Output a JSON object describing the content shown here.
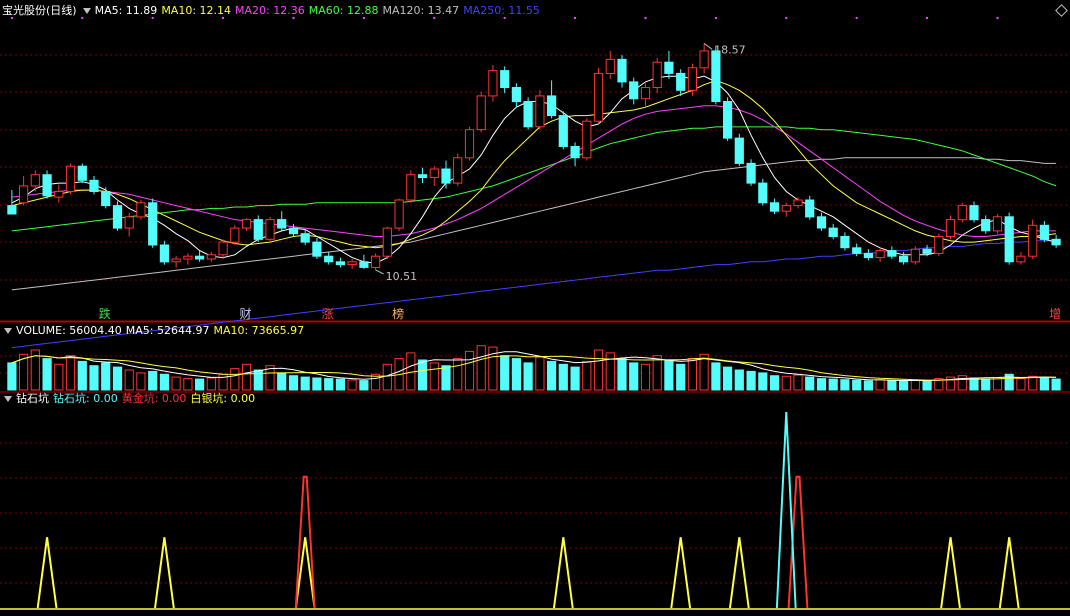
{
  "header": {
    "stock_title": "宝光股份(日线)",
    "ma5": "MA5: 11.89",
    "ma10": "MA10: 12.14",
    "ma20": "MA20: 12.36",
    "ma60": "MA60: 12.88",
    "ma120": "MA120: 13.47",
    "ma250": "MA250: 11.55"
  },
  "price_annotations": {
    "high": "18.57",
    "low": "10.51"
  },
  "event_markers": [
    {
      "label": "跌",
      "color": "#44dd44"
    },
    {
      "label": "财",
      "color": "#c8c8ff"
    },
    {
      "label": "涨",
      "color": "#ff4444"
    },
    {
      "label": "榜",
      "color": "#ffb060"
    },
    {
      "label": "增",
      "color": "#ff4444"
    }
  ],
  "volume_header": {
    "title": "VOLUME: 56004.40",
    "ma5": "MA5: 52644.97",
    "ma10": "MA10: 73665.97"
  },
  "indicator_header": {
    "name": "钻石坑",
    "diamond": "钻石坑: 0.00",
    "gold": "黄金坑: 0.00",
    "silver": "白银坑: 0.00"
  },
  "colors": {
    "up": "#ff3232",
    "down": "#54fcfc",
    "ma5": "#ffffff",
    "ma10": "#ffff40",
    "ma20": "#ff40ff",
    "ma60": "#40ff40",
    "ma120": "#c0c0c0",
    "ma250": "#4040ff",
    "grid": "#800000",
    "axis": "#b00000"
  },
  "chart_data": {
    "type": "candlestick",
    "count": 90,
    "price_ylim": [
      9.3,
      19.4
    ],
    "volume_ylim": [
      0,
      175000
    ],
    "indicator_ylim": [
      0,
      100
    ],
    "ohlc": [
      [
        12.8,
        13.35,
        12.6,
        12.5
      ],
      [
        12.9,
        13.85,
        12.8,
        13.5
      ],
      [
        13.5,
        14.05,
        13.3,
        13.9
      ],
      [
        13.9,
        14.05,
        13.05,
        13.15
      ],
      [
        13.1,
        13.55,
        12.9,
        13.3
      ],
      [
        13.3,
        14.3,
        13.2,
        14.2
      ],
      [
        14.2,
        14.3,
        13.6,
        13.7
      ],
      [
        13.7,
        13.85,
        13.2,
        13.3
      ],
      [
        13.3,
        13.45,
        12.7,
        12.8
      ],
      [
        12.8,
        12.95,
        11.9,
        12.0
      ],
      [
        12.0,
        12.55,
        11.7,
        12.4
      ],
      [
        12.4,
        13.0,
        12.3,
        12.9
      ],
      [
        12.9,
        13.05,
        11.3,
        11.4
      ],
      [
        11.4,
        11.55,
        10.7,
        10.8
      ],
      [
        10.8,
        11.0,
        10.6,
        10.9
      ],
      [
        10.9,
        11.1,
        10.7,
        11.0
      ],
      [
        11.0,
        11.2,
        10.8,
        10.9
      ],
      [
        10.9,
        11.15,
        10.8,
        11.05
      ],
      [
        11.05,
        11.6,
        10.9,
        11.5
      ],
      [
        11.5,
        12.1,
        11.4,
        12.0
      ],
      [
        12.0,
        12.35,
        11.9,
        12.3
      ],
      [
        12.3,
        12.45,
        11.5,
        11.6
      ],
      [
        11.6,
        12.4,
        11.5,
        12.3
      ],
      [
        12.3,
        12.6,
        11.9,
        12.0
      ],
      [
        12.0,
        12.15,
        11.7,
        11.8
      ],
      [
        11.8,
        11.95,
        11.4,
        11.5
      ],
      [
        11.5,
        11.65,
        10.9,
        11.0
      ],
      [
        11.0,
        11.15,
        10.7,
        10.8
      ],
      [
        10.8,
        10.95,
        10.6,
        10.7
      ],
      [
        10.7,
        10.9,
        10.55,
        10.8
      ],
      [
        10.8,
        11.05,
        10.55,
        10.6
      ],
      [
        10.6,
        11.1,
        10.51,
        11.0
      ],
      [
        11.0,
        12.05,
        10.9,
        12.0
      ],
      [
        12.0,
        13.05,
        11.9,
        13.0
      ],
      [
        13.0,
        14.05,
        12.9,
        13.9
      ],
      [
        13.9,
        14.15,
        13.6,
        13.8
      ],
      [
        13.8,
        14.2,
        13.5,
        14.1
      ],
      [
        14.1,
        14.4,
        13.4,
        13.6
      ],
      [
        13.6,
        14.65,
        13.5,
        14.5
      ],
      [
        14.5,
        15.6,
        14.4,
        15.5
      ],
      [
        15.5,
        16.85,
        15.4,
        16.7
      ],
      [
        16.7,
        17.8,
        16.5,
        17.6
      ],
      [
        17.6,
        17.75,
        16.8,
        17.0
      ],
      [
        17.0,
        17.15,
        16.3,
        16.5
      ],
      [
        16.5,
        16.65,
        15.5,
        15.6
      ],
      [
        15.6,
        16.9,
        15.5,
        16.7
      ],
      [
        16.7,
        17.25,
        15.9,
        16.0
      ],
      [
        16.0,
        16.15,
        14.8,
        14.9
      ],
      [
        14.9,
        15.05,
        14.2,
        14.5
      ],
      [
        14.5,
        15.9,
        14.4,
        15.8
      ],
      [
        15.8,
        17.7,
        15.7,
        17.5
      ],
      [
        17.5,
        18.3,
        17.3,
        18.0
      ],
      [
        18.0,
        18.15,
        17.0,
        17.2
      ],
      [
        17.2,
        17.35,
        16.4,
        16.6
      ],
      [
        16.6,
        17.15,
        16.3,
        17.0
      ],
      [
        17.0,
        18.05,
        16.8,
        17.9
      ],
      [
        17.9,
        18.3,
        17.3,
        17.5
      ],
      [
        17.5,
        17.65,
        16.7,
        16.9
      ],
      [
        16.9,
        17.85,
        16.7,
        17.7
      ],
      [
        17.7,
        18.57,
        17.5,
        18.3
      ],
      [
        18.3,
        18.45,
        16.4,
        16.5
      ],
      [
        16.5,
        16.65,
        15.1,
        15.2
      ],
      [
        15.2,
        15.35,
        14.2,
        14.3
      ],
      [
        14.3,
        14.45,
        13.5,
        13.6
      ],
      [
        13.6,
        13.75,
        12.8,
        12.9
      ],
      [
        12.9,
        13.05,
        12.5,
        12.6
      ],
      [
        12.6,
        12.9,
        12.4,
        12.8
      ],
      [
        12.8,
        13.1,
        12.7,
        13.0
      ],
      [
        13.0,
        13.15,
        12.3,
        12.4
      ],
      [
        12.4,
        12.55,
        11.9,
        12.0
      ],
      [
        12.0,
        12.15,
        11.6,
        11.7
      ],
      [
        11.7,
        11.85,
        11.2,
        11.3
      ],
      [
        11.3,
        11.45,
        11.0,
        11.1
      ],
      [
        11.1,
        11.25,
        10.85,
        10.95
      ],
      [
        10.95,
        11.3,
        10.8,
        11.2
      ],
      [
        11.2,
        11.35,
        10.9,
        11.0
      ],
      [
        11.0,
        11.15,
        10.7,
        10.8
      ],
      [
        10.8,
        11.35,
        10.7,
        11.25
      ],
      [
        11.25,
        11.4,
        11.0,
        11.1
      ],
      [
        11.1,
        11.8,
        11.0,
        11.7
      ],
      [
        11.7,
        12.45,
        11.6,
        12.3
      ],
      [
        12.3,
        12.9,
        12.2,
        12.8
      ],
      [
        12.8,
        12.95,
        12.2,
        12.3
      ],
      [
        12.3,
        12.45,
        11.8,
        11.9
      ],
      [
        11.9,
        12.5,
        11.8,
        12.4
      ],
      [
        12.4,
        12.55,
        10.7,
        10.8
      ],
      [
        10.8,
        11.15,
        10.7,
        11.0
      ],
      [
        11.0,
        12.3,
        10.9,
        12.1
      ],
      [
        12.1,
        12.25,
        11.5,
        11.6
      ],
      [
        11.6,
        11.75,
        11.3,
        11.4
      ]
    ],
    "volume": [
      95000,
      125000,
      140000,
      110000,
      90000,
      120000,
      100000,
      85000,
      95000,
      80000,
      70000,
      60000,
      65000,
      55000,
      45000,
      40000,
      38000,
      42000,
      55000,
      75000,
      90000,
      70000,
      85000,
      60000,
      50000,
      45000,
      42000,
      40000,
      38000,
      35000,
      33000,
      55000,
      90000,
      110000,
      130000,
      105000,
      95000,
      85000,
      110000,
      135000,
      155000,
      150000,
      120000,
      110000,
      95000,
      115000,
      100000,
      90000,
      80000,
      100000,
      140000,
      130000,
      110000,
      95000,
      90000,
      120000,
      105000,
      90000,
      110000,
      125000,
      95000,
      80000,
      70000,
      65000,
      60000,
      50000,
      48000,
      52000,
      45000,
      40000,
      38000,
      36000,
      34000,
      32000,
      36000,
      33000,
      31000,
      35000,
      32000,
      40000,
      45000,
      50000,
      42000,
      38000,
      43000,
      55000,
      40000,
      48000,
      42000,
      38000
    ],
    "ma_lines": {
      "MA5": [
        12.9,
        13.1,
        13.4,
        13.55,
        13.6,
        13.6,
        13.65,
        13.55,
        13.35,
        13.0,
        12.7,
        12.5,
        12.35,
        12.1,
        11.8,
        11.55,
        11.2,
        11.0,
        10.95,
        11.05,
        11.35,
        11.6,
        11.75,
        11.9,
        12.0,
        11.95,
        11.7,
        11.45,
        11.2,
        10.95,
        10.8,
        10.75,
        10.95,
        11.3,
        11.8,
        12.4,
        13.1,
        13.6,
        13.85,
        14.1,
        14.6,
        15.3,
        15.9,
        16.3,
        16.5,
        16.5,
        16.4,
        16.1,
        15.8,
        15.6,
        15.7,
        16.1,
        16.6,
        16.9,
        17.2,
        17.35,
        17.4,
        17.4,
        17.3,
        17.4,
        17.2,
        16.8,
        16.2,
        15.3,
        14.5,
        13.8,
        13.3,
        13.0,
        12.8,
        12.6,
        12.4,
        12.1,
        11.8,
        11.5,
        11.3,
        11.15,
        11.05,
        11.05,
        11.05,
        11.15,
        11.4,
        11.75,
        12.0,
        12.2,
        12.3,
        12.05,
        11.85,
        11.75,
        11.6,
        11.5
      ],
      "MA10": [
        12.8,
        12.9,
        13.0,
        13.1,
        13.2,
        13.3,
        13.35,
        13.35,
        13.3,
        13.2,
        13.05,
        12.85,
        12.65,
        12.45,
        12.25,
        12.05,
        11.85,
        11.7,
        11.55,
        11.45,
        11.4,
        11.45,
        11.5,
        11.6,
        11.7,
        11.75,
        11.7,
        11.6,
        11.5,
        11.4,
        11.35,
        11.3,
        11.35,
        11.45,
        11.6,
        11.75,
        11.95,
        12.25,
        12.6,
        12.95,
        13.35,
        13.9,
        14.4,
        14.8,
        15.2,
        15.6,
        15.8,
        15.95,
        16.0,
        16.0,
        16.05,
        16.1,
        16.15,
        16.2,
        16.3,
        16.45,
        16.6,
        16.75,
        16.9,
        17.1,
        17.25,
        17.1,
        16.9,
        16.6,
        16.25,
        15.8,
        15.3,
        14.8,
        14.3,
        13.9,
        13.5,
        13.2,
        12.9,
        12.7,
        12.5,
        12.3,
        12.1,
        11.9,
        11.75,
        11.65,
        11.55,
        11.5,
        11.5,
        11.55,
        11.6,
        11.65,
        11.7,
        11.7,
        11.75,
        11.8
      ],
      "MA20": [
        13.1,
        13.15,
        13.2,
        13.25,
        13.3,
        13.35,
        13.35,
        13.35,
        13.3,
        13.25,
        13.2,
        13.1,
        13.0,
        12.9,
        12.8,
        12.7,
        12.6,
        12.5,
        12.4,
        12.3,
        12.25,
        12.2,
        12.15,
        12.1,
        12.05,
        12.0,
        11.95,
        11.9,
        11.85,
        11.8,
        11.75,
        11.7,
        11.7,
        11.75,
        11.8,
        11.9,
        12.0,
        12.15,
        12.3,
        12.5,
        12.7,
        12.95,
        13.2,
        13.45,
        13.7,
        13.95,
        14.2,
        14.45,
        14.7,
        14.95,
        15.2,
        15.45,
        15.7,
        15.9,
        16.05,
        16.15,
        16.2,
        16.25,
        16.3,
        16.35,
        16.35,
        16.3,
        16.2,
        16.05,
        15.85,
        15.6,
        15.35,
        15.05,
        14.75,
        14.45,
        14.15,
        13.85,
        13.55,
        13.25,
        12.95,
        12.7,
        12.45,
        12.25,
        12.1,
        11.95,
        11.85,
        11.75,
        11.7,
        11.7,
        11.75,
        11.8,
        11.85,
        11.9,
        11.9,
        11.9
      ],
      "MA60": [
        11.9,
        11.95,
        12.0,
        12.05,
        12.1,
        12.15,
        12.2,
        12.25,
        12.3,
        12.35,
        12.4,
        12.45,
        12.5,
        12.55,
        12.6,
        12.65,
        12.65,
        12.7,
        12.7,
        12.75,
        12.75,
        12.8,
        12.8,
        12.85,
        12.85,
        12.85,
        12.9,
        12.9,
        12.9,
        12.9,
        12.9,
        12.9,
        12.9,
        12.9,
        12.95,
        13.0,
        13.05,
        13.1,
        13.2,
        13.3,
        13.4,
        13.5,
        13.65,
        13.8,
        13.95,
        14.1,
        14.25,
        14.4,
        14.55,
        14.7,
        14.85,
        15.0,
        15.1,
        15.2,
        15.3,
        15.4,
        15.45,
        15.5,
        15.55,
        15.55,
        15.6,
        15.6,
        15.6,
        15.6,
        15.6,
        15.6,
        15.6,
        15.55,
        15.55,
        15.5,
        15.5,
        15.45,
        15.4,
        15.35,
        15.3,
        15.25,
        15.2,
        15.15,
        15.05,
        14.95,
        14.85,
        14.75,
        14.6,
        14.45,
        14.3,
        14.15,
        14.0,
        13.85,
        13.65,
        13.5
      ],
      "MA120": [
        9.8,
        9.85,
        9.9,
        9.95,
        10.0,
        10.05,
        10.1,
        10.15,
        10.2,
        10.25,
        10.3,
        10.35,
        10.4,
        10.45,
        10.5,
        10.55,
        10.6,
        10.65,
        10.7,
        10.75,
        10.8,
        10.85,
        10.9,
        10.95,
        11.0,
        11.05,
        11.1,
        11.15,
        11.2,
        11.25,
        11.3,
        11.35,
        11.4,
        11.45,
        11.5,
        11.6,
        11.7,
        11.8,
        11.9,
        12.0,
        12.1,
        12.2,
        12.3,
        12.4,
        12.5,
        12.6,
        12.7,
        12.8,
        12.9,
        13.0,
        13.1,
        13.2,
        13.3,
        13.4,
        13.5,
        13.6,
        13.7,
        13.8,
        13.9,
        14.0,
        14.05,
        14.1,
        14.15,
        14.2,
        14.25,
        14.3,
        14.35,
        14.4,
        14.4,
        14.45,
        14.45,
        14.5,
        14.5,
        14.5,
        14.5,
        14.5,
        14.5,
        14.5,
        14.5,
        14.5,
        14.5,
        14.5,
        14.5,
        14.45,
        14.45,
        14.4,
        14.4,
        14.35,
        14.3,
        14.3
      ],
      "MA250": [
        7.75,
        7.8,
        7.85,
        7.9,
        7.95,
        8.0,
        8.05,
        8.1,
        8.15,
        8.2,
        8.25,
        8.3,
        8.35,
        8.4,
        8.45,
        8.5,
        8.55,
        8.6,
        8.65,
        8.7,
        8.75,
        8.8,
        8.85,
        8.9,
        8.95,
        9.0,
        9.05,
        9.1,
        9.15,
        9.2,
        9.25,
        9.3,
        9.35,
        9.4,
        9.45,
        9.5,
        9.55,
        9.6,
        9.65,
        9.7,
        9.75,
        9.8,
        9.85,
        9.9,
        9.95,
        10.0,
        10.05,
        10.1,
        10.15,
        10.2,
        10.25,
        10.3,
        10.35,
        10.4,
        10.45,
        10.5,
        10.5,
        10.55,
        10.6,
        10.65,
        10.7,
        10.7,
        10.75,
        10.8,
        10.8,
        10.85,
        10.9,
        10.9,
        10.95,
        11.0,
        11.0,
        11.05,
        11.1,
        11.1,
        11.15,
        11.2,
        11.2,
        11.25,
        11.3,
        11.3,
        11.35,
        11.35,
        11.4,
        11.45,
        11.45,
        11.5,
        11.5,
        11.55,
        11.55,
        11.55
      ]
    },
    "indicator_spikes": {
      "silver": [
        [
          3,
          100
        ],
        [
          13,
          100
        ],
        [
          25,
          100
        ],
        [
          47,
          100
        ],
        [
          57,
          100
        ],
        [
          62,
          100
        ],
        [
          80,
          100
        ],
        [
          85,
          100
        ]
      ],
      "gold": [
        [
          25,
          100
        ],
        [
          67,
          100
        ]
      ],
      "diamond": [
        [
          66,
          100
        ]
      ]
    },
    "event_positions": [
      8,
      20,
      27,
      33,
      89
    ]
  }
}
